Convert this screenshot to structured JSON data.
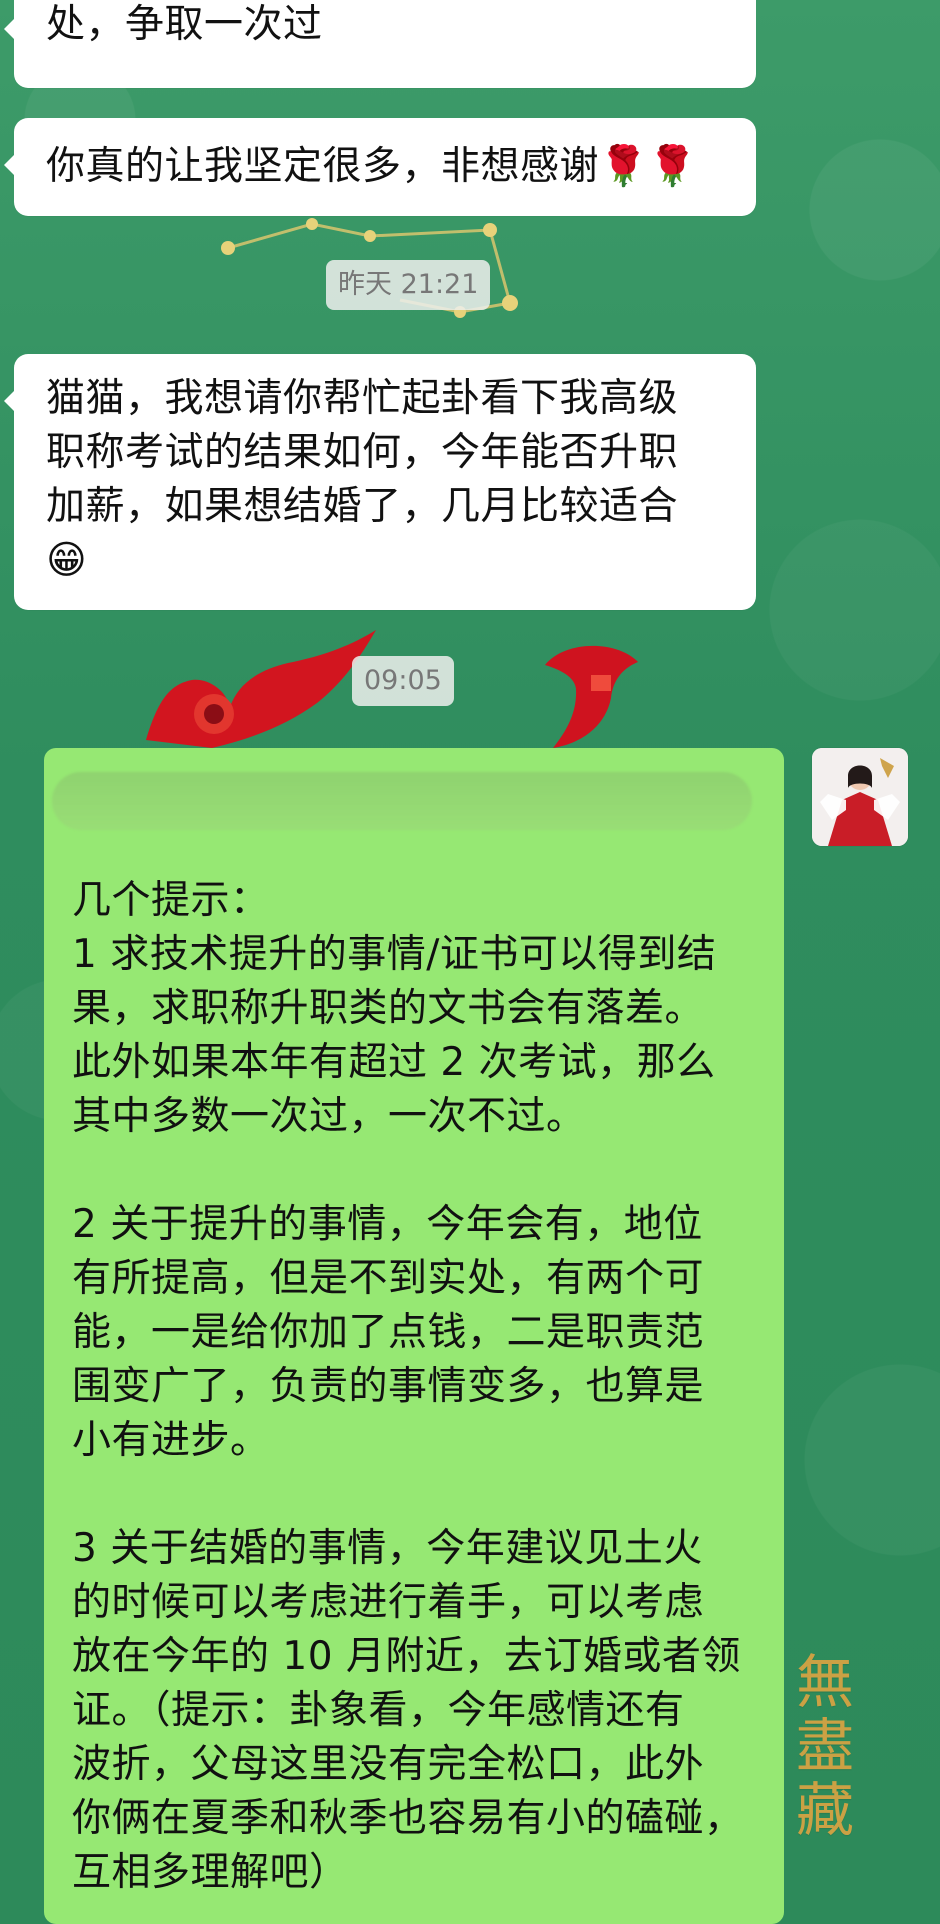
{
  "chat": {
    "messages": [
      {
        "side": "left",
        "text": "处，争取一次过"
      },
      {
        "side": "left",
        "text": "你真的让我坚定很多，非想感谢🌹🌹"
      },
      {
        "type": "timestamp",
        "text": "昨天 21:21"
      },
      {
        "side": "left",
        "text": "猫猫，我想请你帮忙起卦看下我高级\n职称考试的结果如何，今年能否升职\n加薪，如果想结婚了，几月比较适合\n😁"
      },
      {
        "type": "timestamp",
        "text": "09:05"
      },
      {
        "side": "right",
        "text": "几个提示：\n1 求技术提升的事情/证书可以得到结\n果，求职称升职类的文书会有落差。\n此外如果本年有超过 2 次考试，那么\n其中多数一次过，一次不过。\n\n2 关于提升的事情，今年会有，地位\n有所提高，但是不到实处，有两个可\n能，一是给你加了点钱，二是职责范\n围变广了，负责的事情变多，也算是\n小有进步。\n\n3 关于结婚的事情，今年建议见土火\n的时候可以考虑进行着手，可以考虑\n放在今年的 10 月附近，去订婚或者领\n证。（提示：卦象看，今年感情还有\n波折，父母这里没有完全松口，此外\n你俩在夏季和秋季也容易有小的磕碰，\n互相多理解吧）"
      }
    ]
  },
  "decor": {
    "seal": "無\n盡\n藏"
  }
}
